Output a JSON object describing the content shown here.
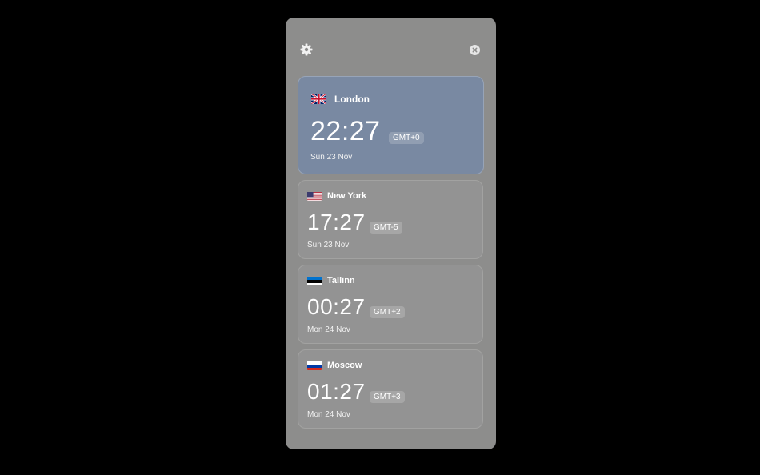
{
  "toolbar": {
    "settings_icon": "gear-icon",
    "close_icon": "close-icon"
  },
  "clocks": [
    {
      "flag": "uk-flag-icon",
      "city": "London",
      "time": "22:27",
      "tz": "GMT+0",
      "date": "Sun 23 Nov",
      "active": true
    },
    {
      "flag": "us-flag-icon",
      "city": "New York",
      "time": "17:27",
      "tz": "GMT-5",
      "date": "Sun 23 Nov",
      "active": false
    },
    {
      "flag": "estonia-flag-icon",
      "city": "Tallinn",
      "time": "00:27",
      "tz": "GMT+2",
      "date": "Mon 24 Nov",
      "active": false
    },
    {
      "flag": "russia-flag-icon",
      "city": "Moscow",
      "time": "01:27",
      "tz": "GMT+3",
      "date": "Mon 24 Nov",
      "active": false
    }
  ],
  "colors": {
    "panel": "#8d8d8c",
    "card": "#939393",
    "active_card": "#7989a2"
  }
}
